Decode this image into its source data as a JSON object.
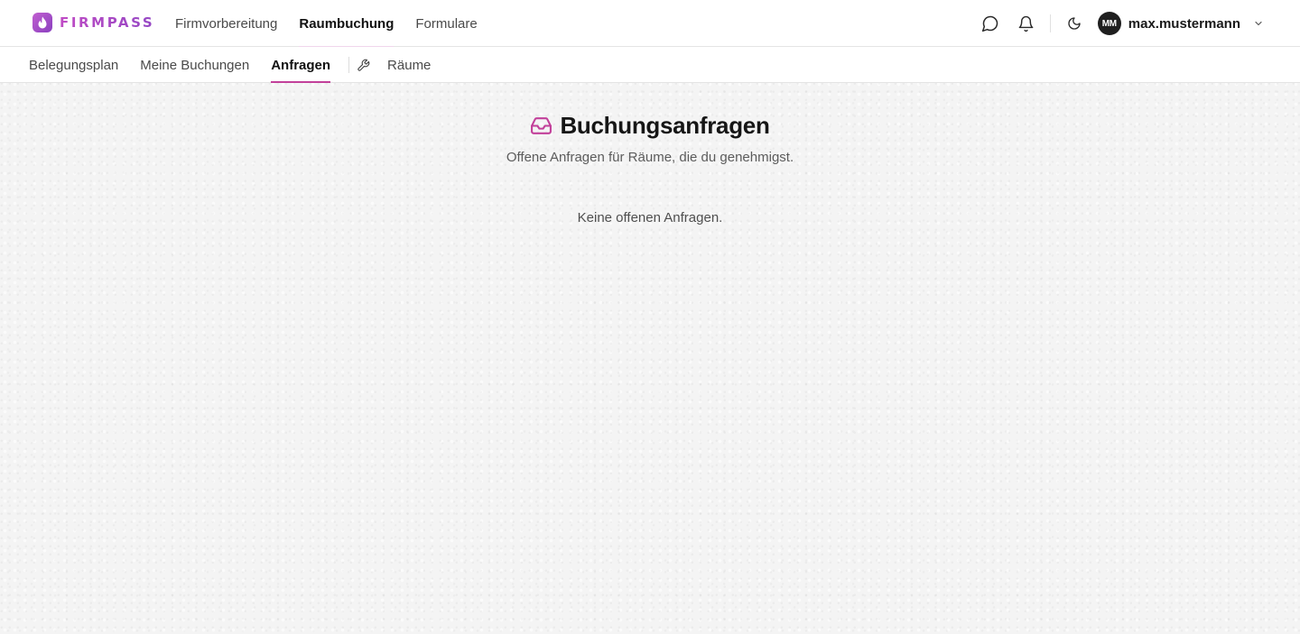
{
  "brand": {
    "name": "FIRMPASS",
    "accent": "#c2409a"
  },
  "main_nav": [
    {
      "label": "Firmvorbereitung",
      "active": false
    },
    {
      "label": "Raumbuchung",
      "active": true
    },
    {
      "label": "Formulare",
      "active": false
    }
  ],
  "user": {
    "initials": "MM",
    "name": "max.mustermann"
  },
  "sub_nav": {
    "items": [
      {
        "label": "Belegungsplan",
        "active": false
      },
      {
        "label": "Meine Buchungen",
        "active": false
      },
      {
        "label": "Anfragen",
        "active": true
      }
    ],
    "admin_icon": "wrench-icon",
    "admin_items": [
      {
        "label": "Räume",
        "active": false
      }
    ]
  },
  "page": {
    "icon": "inbox-icon",
    "title": "Buchungsanfragen",
    "subtitle": "Offene Anfragen für Räume, die du genehmigst.",
    "empty_message": "Keine offenen Anfragen."
  }
}
